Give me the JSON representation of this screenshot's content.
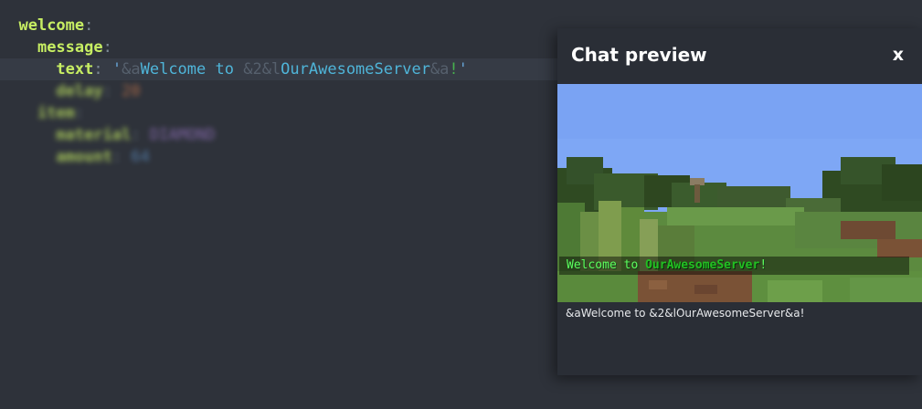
{
  "editor": {
    "line1_key": "welcome",
    "line2_key": "message",
    "line3_key": "text",
    "line3_value": {
      "quote_open": "'",
      "code_a1": "&a",
      "text1": "Welcome to ",
      "code_2": "&2",
      "code_l": "&l",
      "text2": "OurAwesomeServer",
      "code_a2": "&a",
      "text3": "!",
      "quote_close": "'"
    },
    "blurred_lines": {
      "l4_key": "delay",
      "l4_value": "20",
      "l5_key": "item",
      "l6_key": "material",
      "l6_value": "DIAMOND",
      "l7_key": "amount",
      "l7_value": "64"
    },
    "colon": ":"
  },
  "chat_preview": {
    "title": "Chat preview",
    "close_label": "x",
    "rendered_prefix": "Welcome to ",
    "rendered_server": "OurAwesomeServer",
    "rendered_suffix": "!",
    "raw_message": "&aWelcome to &2&lOurAwesomeServer&a!"
  }
}
